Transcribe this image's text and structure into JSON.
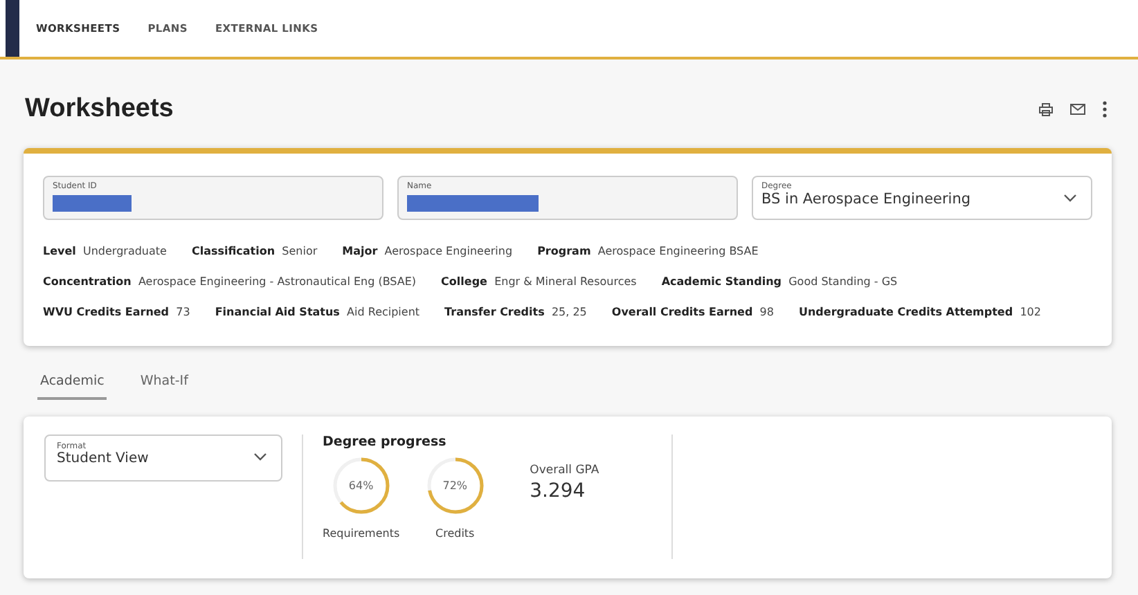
{
  "nav": {
    "items": [
      {
        "label": "WORKSHEETS",
        "selected": true
      },
      {
        "label": "PLANS",
        "selected": false
      },
      {
        "label": "EXTERNAL LINKS",
        "selected": false
      }
    ]
  },
  "page": {
    "title": "Worksheets"
  },
  "student": {
    "fields": [
      {
        "label": "Student ID",
        "kind": "redacted"
      },
      {
        "label": "Name",
        "kind": "redacted"
      },
      {
        "label": "Degree",
        "kind": "select",
        "value": "BS in Aerospace Engineering"
      }
    ],
    "info_rows": [
      [
        {
          "label": "Level",
          "value": "Undergraduate"
        },
        {
          "label": "Classification",
          "value": "Senior"
        },
        {
          "label": "Major",
          "value": "Aerospace Engineering"
        },
        {
          "label": "Program",
          "value": "Aerospace Engineering BSAE"
        }
      ],
      [
        {
          "label": "Concentration",
          "value": "Aerospace Engineering - Astronautical Eng (BSAE)"
        },
        {
          "label": "College",
          "value": "Engr & Mineral Resources"
        },
        {
          "label": "Academic Standing",
          "value": "Good Standing - GS"
        }
      ],
      [
        {
          "label": "WVU Credits Earned",
          "value": "73"
        },
        {
          "label": "Financial Aid Status",
          "value": "Aid Recipient"
        },
        {
          "label": "Transfer Credits",
          "value": "25, 25"
        },
        {
          "label": "Overall Credits Earned",
          "value": "98"
        },
        {
          "label": "Undergraduate Credits Attempted",
          "value": "102"
        }
      ]
    ]
  },
  "tabs": [
    {
      "label": "Academic",
      "selected": true
    },
    {
      "label": "What-If",
      "selected": false
    }
  ],
  "format": {
    "label": "Format",
    "value": "Student View"
  },
  "progress": {
    "title": "Degree progress",
    "rings": [
      {
        "percent": "64%",
        "label": "Requirements",
        "level": 0.64
      },
      {
        "percent": "72%",
        "label": "Credits",
        "level": 0.72
      }
    ],
    "gpa": {
      "label": "Overall GPA",
      "value": "3.294"
    }
  }
}
